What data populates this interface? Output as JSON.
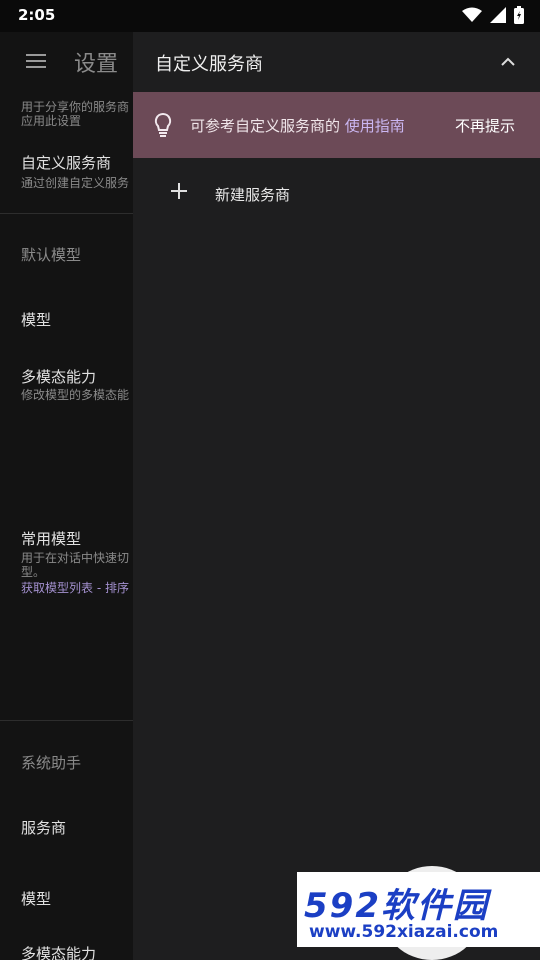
{
  "status": {
    "time": "2:05"
  },
  "left": {
    "title": "设置",
    "items": [
      {
        "sub1": "用于分享你的服务商",
        "sub2": "应用此设置"
      },
      {
        "label": "自定义服务商",
        "sub": "通过创建自定义服务"
      },
      {
        "label": "默认模型"
      },
      {
        "label": "模型"
      },
      {
        "label": "多模态能力",
        "sub": "修改模型的多模态能"
      },
      {
        "label": "常用模型",
        "sub1": "用于在对话中快速切",
        "sub2": "型。",
        "link": "获取模型列表 - 排序"
      },
      {
        "label": "系统助手"
      },
      {
        "label": "服务商"
      },
      {
        "label": "模型"
      },
      {
        "label": "多模态能力"
      }
    ]
  },
  "panel": {
    "title": "自定义服务商",
    "tip": {
      "text": "可参考自定义服务商的 ",
      "link": "使用指南",
      "dismiss": "不再提示"
    },
    "new_label": "新建服务商"
  },
  "watermark": {
    "brand": "592软件园",
    "url": "www.592xiazai.com"
  }
}
